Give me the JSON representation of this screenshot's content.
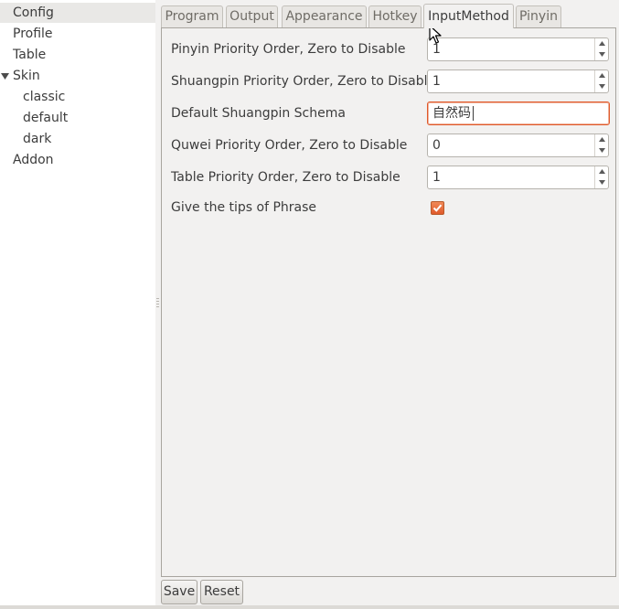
{
  "sidebar": {
    "items": [
      {
        "label": "Config"
      },
      {
        "label": "Profile"
      },
      {
        "label": "Table"
      },
      {
        "label": "Skin"
      },
      {
        "label": "classic"
      },
      {
        "label": "default"
      },
      {
        "label": "dark"
      },
      {
        "label": "Addon"
      }
    ]
  },
  "tabs": [
    {
      "label": "Program"
    },
    {
      "label": "Output"
    },
    {
      "label": "Appearance"
    },
    {
      "label": "Hotkey"
    },
    {
      "label": "InputMethod"
    },
    {
      "label": "Pinyin"
    }
  ],
  "form": {
    "pinyin_priority": {
      "label": "Pinyin Priority Order, Zero to Disable",
      "value": "1"
    },
    "shuangpin_priority": {
      "label": "Shuangpin Priority Order, Zero to Disable",
      "value": "1"
    },
    "shuangpin_schema": {
      "label": "Default Shuangpin Schema",
      "value": "自然码"
    },
    "quwei_priority": {
      "label": "Quwei Priority Order, Zero to Disable",
      "value": "0"
    },
    "table_priority": {
      "label": "Table Priority Order, Zero to Disable",
      "value": "1"
    },
    "phrase_tips": {
      "label": "Give the tips of Phrase",
      "checked": true
    }
  },
  "buttons": {
    "save": "Save",
    "reset": "Reset"
  },
  "colors": {
    "accent": "#e0592a",
    "window_bg": "#f2f1f0",
    "text": "#3c3c3c"
  },
  "icons": {
    "tree_expander": "triangle-down-icon",
    "spin_up": "arrow-up-icon",
    "spin_down": "arrow-down-icon",
    "checkbox": "checkmark-icon",
    "pointer": "mouse-pointer-icon"
  }
}
